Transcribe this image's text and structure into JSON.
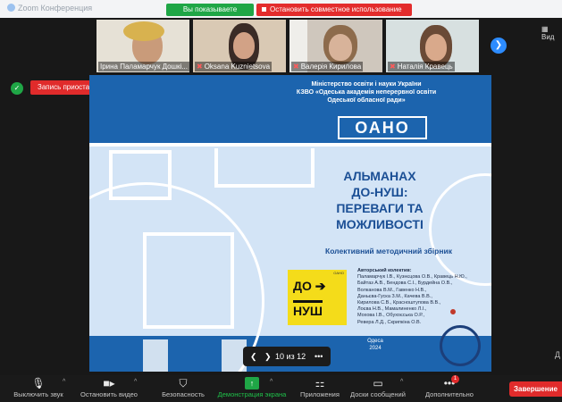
{
  "window": {
    "app_title": "Zoom Конференция",
    "share_status": "Вы показываете слайды",
    "stop_share": "Остановить совместное использование",
    "view_label": "Вид"
  },
  "participants": [
    {
      "name": "Ірина Паламарчук Дошкі...",
      "muted": false
    },
    {
      "name": "Oksana Kuznietsova",
      "muted": true
    },
    {
      "name": "Валерія Кирилова",
      "muted": true
    },
    {
      "name": "Наталія Кравець",
      "muted": true
    }
  ],
  "recording": {
    "status": "Запись приостановлена",
    "resume_icon": "play-icon",
    "stop_icon": "stop-icon"
  },
  "slide": {
    "ministry": "Міністерство освіти і науки України",
    "institution": "КЗВО «Одеська академія неперервної освіти",
    "region": "Одеської обласної ради»",
    "logo_text": "ОАНО",
    "title_1": "АЛЬМАНАХ",
    "title_2": "ДО-НУШ:",
    "title_3": "ПЕРЕВАГИ ТА",
    "title_4": "МОЖЛИВОСТІ",
    "subtitle": "Колективний методичний збірник",
    "book_logo_top": "ДО",
    "book_logo_bottom": "НУШ",
    "book_logo_small": "ОАНО",
    "authors_header": "Авторський колектив:",
    "authors": [
      "Паламарчук І.В., Кузнєцова О.В., Кравець Н.Ю.,",
      "Байтаз А.В., Бендова С.І., Бурдейна О.В.,",
      "Волканова В.М., Гавенко Н.В.,",
      "Даньєва-Гуска З.М., Качева В.В.,",
      "Кирилова С.В., Красноштупова В.В.,",
      "Лоєва Н.В., Мамалиненко Л.І.,",
      "Мохова І.В., Обухоєська О.Р.,",
      "Реверa Л.Д., Скрипкіна О.В."
    ],
    "city": "Одеса",
    "year": "2024"
  },
  "pager": {
    "text": "10 из 12",
    "more": "•••"
  },
  "side_letter": "Д",
  "toolbar": {
    "mute": "Выключить звук",
    "video": "Остановить видео",
    "security": "Безопасность",
    "share": "Демонстрация экрана",
    "apps": "Приложения",
    "whiteboard": "Доски сообщений",
    "more": "Дополнительно",
    "more_badge": "1",
    "end": "Завершение"
  }
}
